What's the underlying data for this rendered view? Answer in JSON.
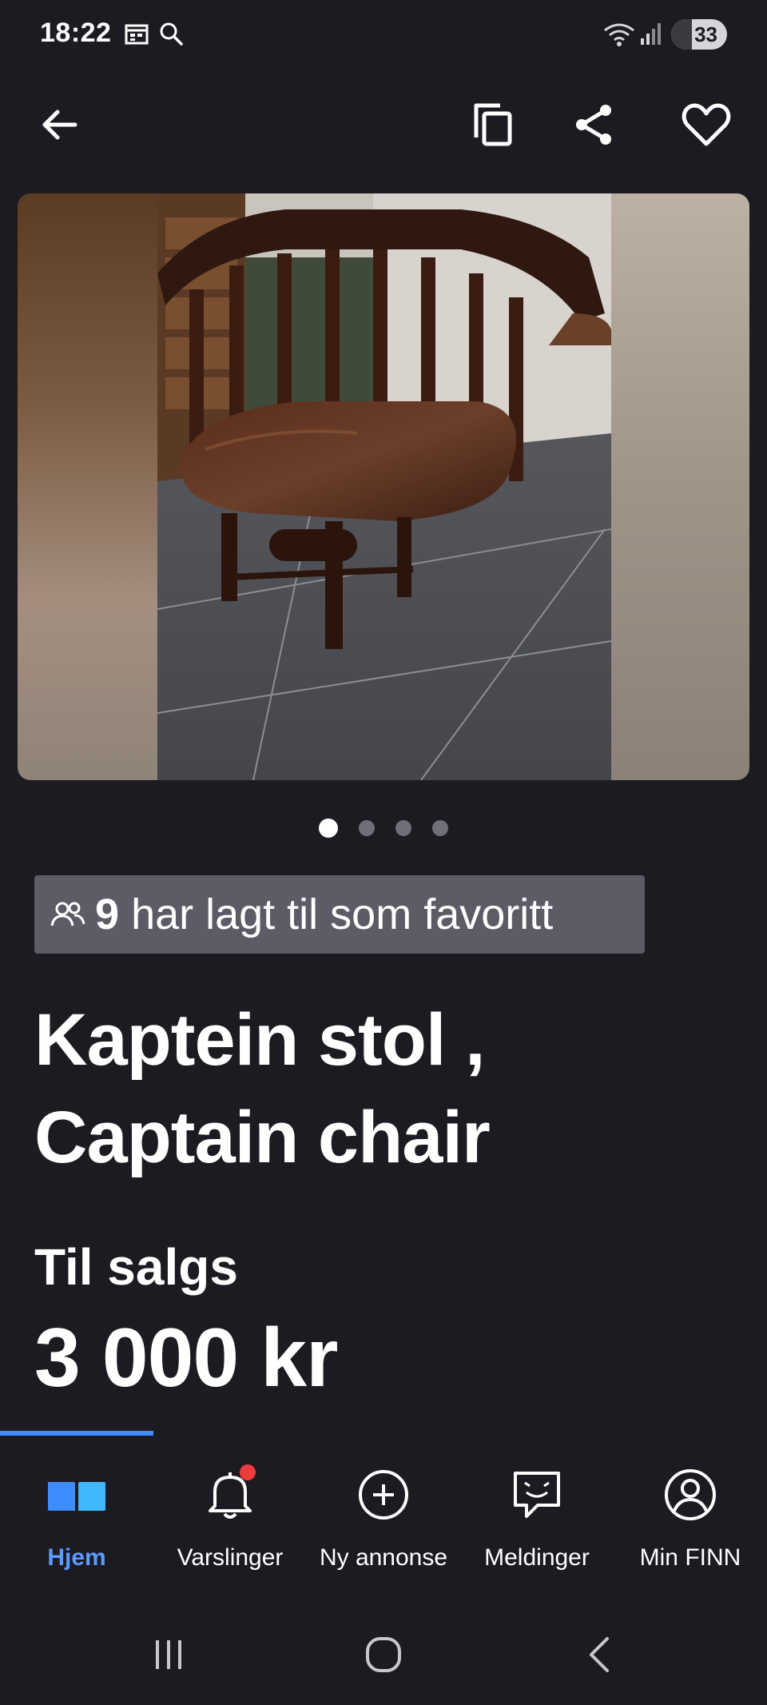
{
  "status_bar": {
    "time": "18:22",
    "battery": "33",
    "icons": [
      "calendar-icon",
      "search-icon",
      "wifi-icon",
      "signal-icon",
      "battery-icon"
    ]
  },
  "top_bar": {
    "icons": [
      "back-arrow-icon",
      "copy-icon",
      "share-icon",
      "heart-icon"
    ]
  },
  "gallery": {
    "image_count": 4,
    "active_index": 1
  },
  "favorites": {
    "count": "9",
    "text": "har lagt til som favoritt",
    "icon": "people-icon"
  },
  "listing": {
    "title_line1": "Kaptein stol ,",
    "title_line2": "Captain chair",
    "status": "Til salgs",
    "price": "3 000 kr"
  },
  "bottom_nav": {
    "items": [
      {
        "label": "Hjem",
        "icon": "home-icon",
        "active": true
      },
      {
        "label": "Varslinger",
        "icon": "bell-icon",
        "badge": true
      },
      {
        "label": "Ny annonse",
        "icon": "plus-circle-icon"
      },
      {
        "label": "Meldinger",
        "icon": "chat-icon"
      },
      {
        "label": "Min FINN",
        "icon": "profile-icon"
      }
    ]
  },
  "colors": {
    "background": "#1b1b21",
    "accent": "#3f8cff",
    "badge_bg": "#5b5c66",
    "notification": "#ee3b3b"
  },
  "system_nav": [
    "recents-icon",
    "home-circle-icon",
    "back-chevron-icon"
  ]
}
